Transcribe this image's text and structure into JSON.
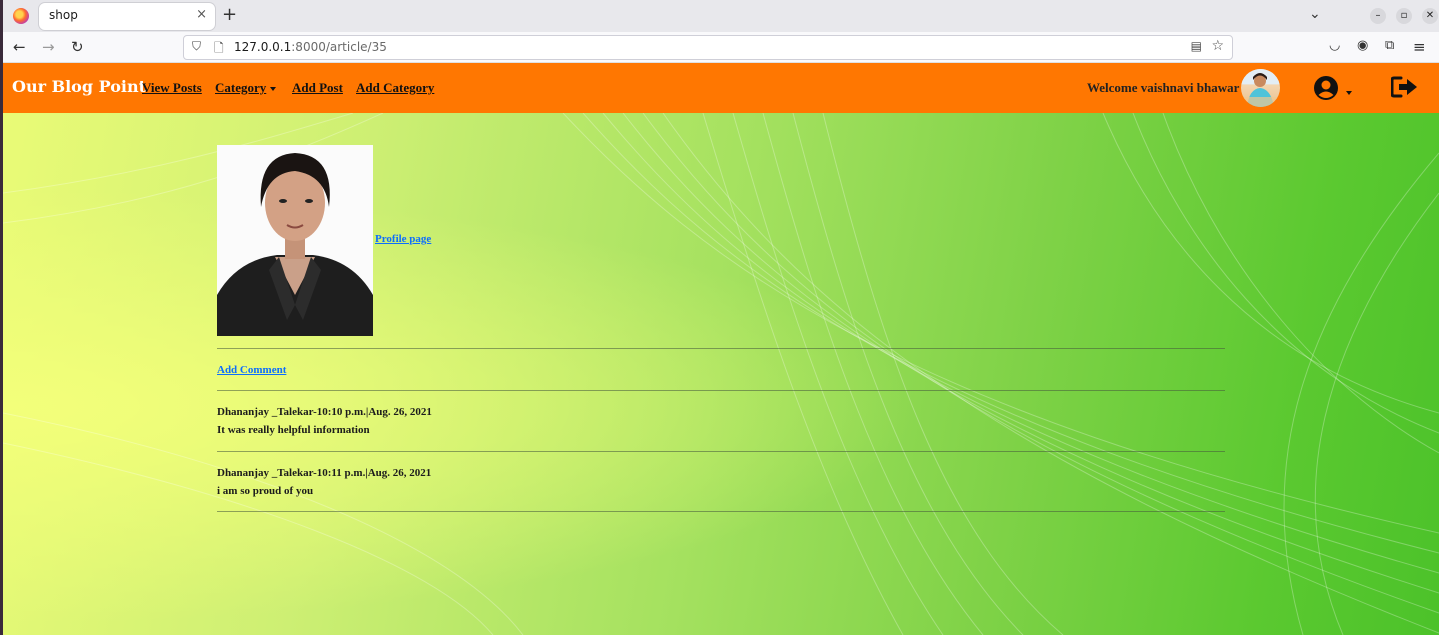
{
  "browser": {
    "tab_title": "shop",
    "tab_close": "×",
    "new_tab": "+",
    "url_host": "127.0.0.1",
    "url_path": ":8000/article/35",
    "icons": [
      "back-icon",
      "forward-icon",
      "reload-icon",
      "shield-icon",
      "page-icon",
      "reader-icon",
      "star-icon",
      "pocket-icon",
      "account-icon",
      "extensions-icon",
      "menu-icon"
    ]
  },
  "site": {
    "brand": "Our Blog Point",
    "nav": {
      "view_posts": "View Posts",
      "category": "Category",
      "add_post": "Add Post",
      "add_category": "Add Category"
    },
    "welcome": "Welcome vaishnavi bhawar",
    "colors": {
      "navbar": "#ff7701",
      "link": "#0d6efd"
    }
  },
  "article": {
    "profile_link": "Profile page",
    "add_comment": "Add Comment",
    "comments": [
      {
        "meta": "Dhananjay _Talekar-10:10 p.m.|Aug. 26, 2021",
        "body": "It was really helpful information"
      },
      {
        "meta": "Dhananjay _Talekar-10:11 p.m.|Aug. 26, 2021",
        "body": "i am so proud of you"
      }
    ]
  }
}
